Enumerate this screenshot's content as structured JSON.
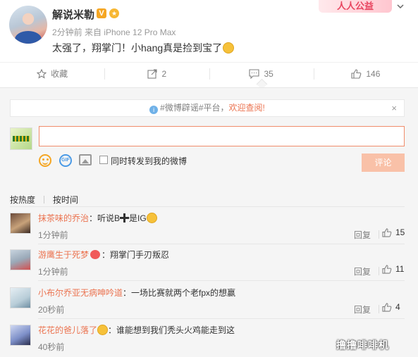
{
  "post": {
    "username": "解说米勒",
    "verified_badge": "V",
    "meta": "2分钟前 来自 iPhone 12 Pro Max",
    "text": "太强了，翔掌门！小hang真是捡到宝了",
    "public_badge": "人人公益"
  },
  "actions": {
    "favorite_label": "收藏",
    "repost_count": "2",
    "comment_count": "35",
    "like_count": "146"
  },
  "comment_box": {
    "notice_prefix": "#微博辟谣#平台，",
    "notice_highlight": "欢迎查阅!",
    "notice_close": "×",
    "input_value": "",
    "gif_label": "GIF",
    "repost_label": "同时转发到我的微博",
    "submit_label": "评论"
  },
  "sort": {
    "by_hot": "按热度",
    "by_time": "按时间"
  },
  "comments": [
    {
      "user": "抹茶味的乔治",
      "text_before": "：听说B",
      "text_after": "是IG",
      "time": "1分钟前",
      "reply": "回复",
      "likes": "15"
    },
    {
      "user": "游鹰生于死梦",
      "text": "：翔掌门手刃叛忍",
      "time": "1分钟前",
      "reply": "回复",
      "likes": "11"
    },
    {
      "user": "小布尔乔亚无病呻吟道",
      "text": "：一场比赛就两个老fpx的想赢",
      "time": "20秒前",
      "reply": "回复",
      "likes": "4"
    },
    {
      "user": "花花的爸儿落了",
      "text": "：谁能想到我们秃头火鸡能走到这",
      "time": "40秒前"
    }
  ],
  "watermark": "撸撸啡啡机",
  "colors": {
    "accent": "#eb7350",
    "background_gray": "#f5f5f5",
    "submit_disabled": "#f9c1a8"
  }
}
